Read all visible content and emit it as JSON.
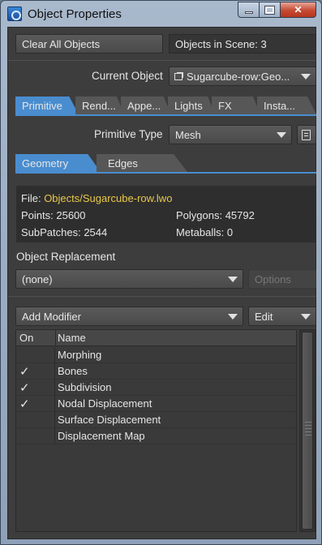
{
  "window": {
    "title": "Object Properties"
  },
  "top": {
    "clear_all_label": "Clear All Objects",
    "objects_in_scene": "Objects in Scene: 3",
    "current_object_label": "Current Object",
    "current_object_value": "Sugarcube-row:Geo..."
  },
  "tabs": [
    {
      "label": "Primitive",
      "active": true
    },
    {
      "label": "Rend...",
      "active": false
    },
    {
      "label": "Appe...",
      "active": false
    },
    {
      "label": "Lights",
      "active": false
    },
    {
      "label": "FX",
      "active": false
    },
    {
      "label": "Insta...",
      "active": false
    }
  ],
  "primitive": {
    "type_label": "Primitive Type",
    "type_value": "Mesh"
  },
  "subtabs": [
    {
      "label": "Geometry",
      "active": true
    },
    {
      "label": "Edges",
      "active": false
    }
  ],
  "info": {
    "file_label": "File:",
    "file_value": "Objects/Sugarcube-row.lwo",
    "points": "Points: 25600",
    "polygons": "Polygons: 45792",
    "subpatches": "SubPatches: 2544",
    "metaballs": "Metaballs: 0"
  },
  "replacement": {
    "label": "Object Replacement",
    "value": "(none)",
    "options_label": "Options"
  },
  "modifiers": {
    "add_label": "Add Modifier",
    "edit_label": "Edit",
    "col_on": "On",
    "col_name": "Name",
    "check_glyph": "✓",
    "rows": [
      {
        "on": false,
        "name": "Morphing"
      },
      {
        "on": true,
        "name": "Bones"
      },
      {
        "on": true,
        "name": "Subdivision"
      },
      {
        "on": true,
        "name": "Nodal Displacement"
      },
      {
        "on": false,
        "name": "Surface Displacement"
      },
      {
        "on": false,
        "name": "Displacement Map"
      }
    ]
  },
  "colors": {
    "accent": "#4a8dcf",
    "file_path": "#e8c84b",
    "panel_bg": "#3d3d3d"
  }
}
